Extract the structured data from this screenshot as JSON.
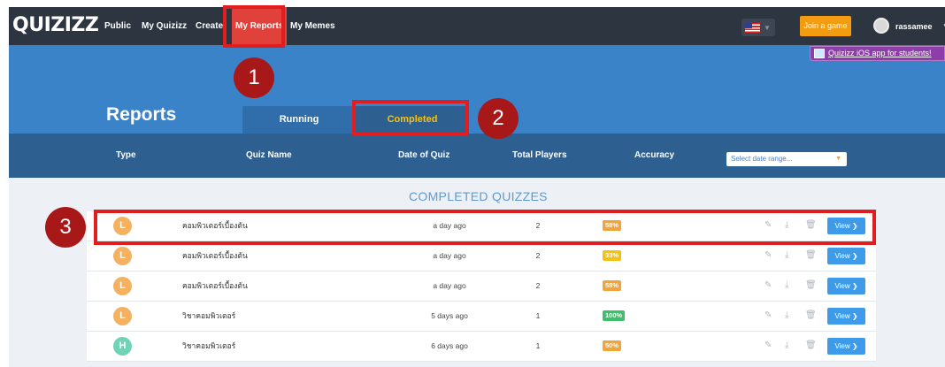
{
  "nav": {
    "logo": "QUIZIZZ",
    "links": [
      "Public",
      "My Quizizz",
      "Create",
      "My Reports",
      "My Memes"
    ],
    "join_label": "Join a game",
    "username": "rassamee",
    "flag_icon": "us-flag-icon"
  },
  "banner": {
    "ios_label": "Quizizz iOS app for students!"
  },
  "page": {
    "title": "Reports",
    "tabs": [
      "Running",
      "Completed"
    ],
    "active_tab": "Completed"
  },
  "columns": [
    "Type",
    "Quiz Name",
    "Date of Quiz",
    "Total Players",
    "Accuracy"
  ],
  "date_select": {
    "placeholder": "Select date range..."
  },
  "section_title": "COMPLETED QUIZZES",
  "rows": [
    {
      "initial": "L",
      "avatar_color": "#f5b160",
      "name": "คอมพิวเตอร์เบื้องต้น",
      "date": "a day ago",
      "players": "2",
      "accuracy": "58%",
      "acc_color": "#f0a43a",
      "view": "View ❯"
    },
    {
      "initial": "L",
      "avatar_color": "#f5b160",
      "name": "คอมพิวเตอร์เบื้องต้น",
      "date": "a day ago",
      "players": "2",
      "accuracy": "33%",
      "acc_color": "#f5c211",
      "view": "View ❯"
    },
    {
      "initial": "L",
      "avatar_color": "#f5b160",
      "name": "คอมพิวเตอร์เบื้องต้น",
      "date": "a day ago",
      "players": "2",
      "accuracy": "58%",
      "acc_color": "#f0a43a",
      "view": "View ❯"
    },
    {
      "initial": "L",
      "avatar_color": "#f5b160",
      "name": "วิชาคอมพิวเตอร์",
      "date": "5 days ago",
      "players": "1",
      "accuracy": "100%",
      "acc_color": "#3cc16a",
      "view": "View ❯"
    },
    {
      "initial": "H",
      "avatar_color": "#6fd3b5",
      "name": "วิชาคอมพิวเตอร์",
      "date": "6 days ago",
      "players": "1",
      "accuracy": "50%",
      "acc_color": "#f0a43a",
      "view": "View ❯"
    }
  ],
  "row_icons": [
    "pencil-icon",
    "download-icon",
    "trash-icon"
  ],
  "callouts": [
    "1",
    "2",
    "3"
  ],
  "colors": {
    "nav_bg": "#2d3540",
    "hero_blue": "#3a83c9",
    "header_bar": "#2d5f90",
    "highlight_red": "#e11d1d",
    "callout_red": "#a81818"
  }
}
